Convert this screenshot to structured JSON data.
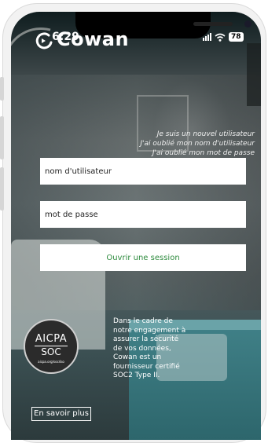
{
  "status_bar": {
    "time": "6:29",
    "battery": "78",
    "icons": [
      "signal-icon",
      "wifi-icon",
      "battery-icon"
    ]
  },
  "brand": {
    "name": "Cowan",
    "logo_icon": "cowan-logo-icon"
  },
  "links": {
    "new_user": "Je suis un nouvel utilisateur",
    "forgot_username": "J'ai oublié mon nom d'utilisateur",
    "forgot_password": "J'ai oublié mon mot de passe"
  },
  "login": {
    "username_placeholder": "nom d'utilisateur",
    "password_placeholder": "mot de passe",
    "submit_label": "Ouvrir une session"
  },
  "soc": {
    "badge_top": "AICPA",
    "badge_bottom": "SOC",
    "badge_url": "aicpa.org/soc4so",
    "description": "Dans le cadre de notre engagement à assurer la sécurité de vos données, Cowan est un fournisseur certifié SOC2 Type II.",
    "learn_more_label": "En savoir plus"
  },
  "colors": {
    "accent_green": "#2e8b3e",
    "field_bg": "#ffffff",
    "text_light": "#ffffff"
  }
}
